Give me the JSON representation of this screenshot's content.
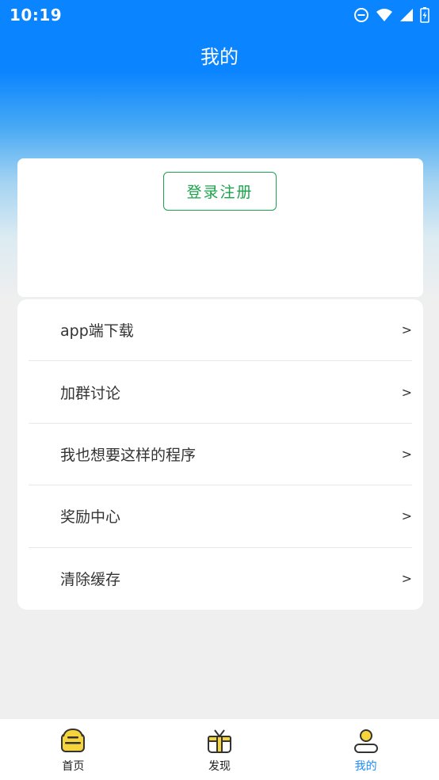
{
  "status_bar": {
    "time": "10:19",
    "icons": [
      "do-not-disturb-icon",
      "wifi-icon",
      "signal-icon",
      "battery-charging-icon"
    ]
  },
  "header": {
    "title": "我的"
  },
  "login_card": {
    "button_label": "登录注册",
    "accent_color": "#1aa34a"
  },
  "menu": {
    "items": [
      {
        "label": "app端下载",
        "arrow": ">"
      },
      {
        "label": "加群讨论",
        "arrow": ">"
      },
      {
        "label": "我也想要这样的程序",
        "arrow": ">"
      },
      {
        "label": "奖励中心",
        "arrow": ">"
      },
      {
        "label": "清除缓存",
        "arrow": ">"
      }
    ]
  },
  "tab_bar": {
    "active_color": "#1a8cff",
    "tabs": [
      {
        "label": "首页",
        "icon": "home-icon",
        "active": false
      },
      {
        "label": "发现",
        "icon": "gift-icon",
        "active": false
      },
      {
        "label": "我的",
        "icon": "user-icon",
        "active": true
      }
    ]
  }
}
